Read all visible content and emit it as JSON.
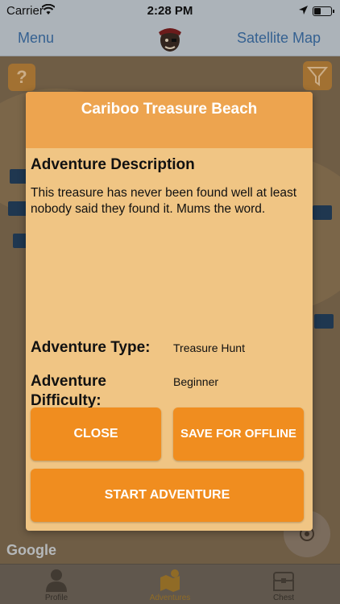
{
  "status_bar": {
    "carrier": "Carrier",
    "time": "2:28 PM"
  },
  "nav": {
    "left_label": "Menu",
    "right_label": "Satellite Map"
  },
  "map": {
    "help_icon": "question-mark-icon",
    "help_glyph": "?",
    "filter_icon": "filter-icon",
    "attribution": "Google"
  },
  "modal": {
    "title": "Cariboo Treasure Beach",
    "description_heading": "Adventure Description",
    "description": "This treasure has never been found well at least nobody said they found it. Mums the word.",
    "type_label": "Adventure Type:",
    "type_value": "Treasure Hunt",
    "difficulty_label": "Adventure Difficulty:",
    "difficulty_value": "Beginner",
    "close_label": "CLOSE",
    "save_label": "SAVE FOR OFFLINE",
    "start_label": "START ADVENTURE"
  },
  "tabs": [
    {
      "label": "Profile",
      "icon": "person-icon"
    },
    {
      "label": "Adventures",
      "icon": "map-icon",
      "active": true
    },
    {
      "label": "Chest",
      "icon": "chest-icon"
    }
  ],
  "colors": {
    "modal_header": "#eda44f",
    "modal_body": "#f0c584",
    "button": "#f08d1f",
    "nav_link": "#3d6fa6"
  }
}
